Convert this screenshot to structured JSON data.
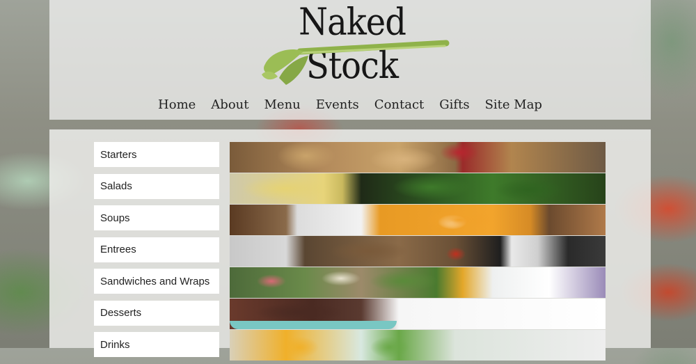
{
  "site": {
    "title": "Naked Stock"
  },
  "nav": {
    "items": [
      {
        "label": "Home"
      },
      {
        "label": "About"
      },
      {
        "label": "Menu"
      },
      {
        "label": "Events"
      },
      {
        "label": "Contact"
      },
      {
        "label": "Gifts"
      },
      {
        "label": "Site Map"
      }
    ]
  },
  "menu": {
    "categories": [
      {
        "label": "Starters"
      },
      {
        "label": "Salads"
      },
      {
        "label": "Soups"
      },
      {
        "label": "Entrees"
      },
      {
        "label": "Sandwiches and Wraps"
      },
      {
        "label": "Desserts"
      },
      {
        "label": "Drinks"
      }
    ]
  },
  "colors": {
    "panel": "#f0f0ee",
    "text": "#222222",
    "celery": "#8fb24a"
  }
}
